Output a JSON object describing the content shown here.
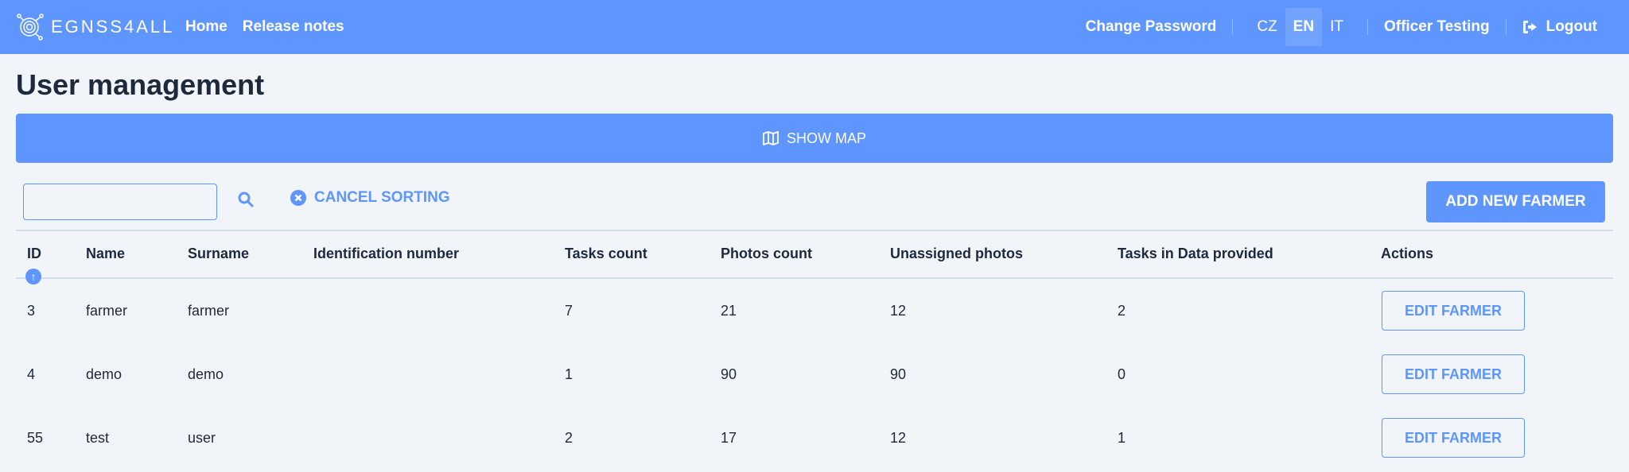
{
  "header": {
    "logo": "EGNSS4ALL",
    "nav": [
      "Home",
      "Release notes"
    ],
    "change_password": "Change Password",
    "languages": [
      "CZ",
      "EN",
      "IT"
    ],
    "active_language": "EN",
    "user": "Officer Testing",
    "logout": "Logout"
  },
  "page_title": "User management",
  "show_map": "SHOW MAP",
  "search": {
    "value": "",
    "placeholder": ""
  },
  "cancel_sorting": "CANCEL SORTING",
  "add_farmer": "ADD NEW FARMER",
  "table": {
    "columns": [
      "ID",
      "Name",
      "Surname",
      "Identification number",
      "Tasks count",
      "Photos count",
      "Unassigned photos",
      "Tasks in Data provided",
      "Actions"
    ],
    "sort": {
      "column": "ID",
      "direction": "ascending"
    },
    "rows": [
      [
        "3",
        "farmer",
        "farmer",
        "",
        "7",
        "21",
        "12",
        "2"
      ],
      [
        "4",
        "demo",
        "demo",
        "",
        "1",
        "90",
        "90",
        "0"
      ],
      [
        "55",
        "test",
        "user",
        "",
        "2",
        "17",
        "12",
        "1"
      ]
    ],
    "action_label": "EDIT FARMER"
  },
  "colors": {
    "primary": "#5e95fe",
    "background": "#f1f5fa",
    "text": "#1e293b"
  }
}
